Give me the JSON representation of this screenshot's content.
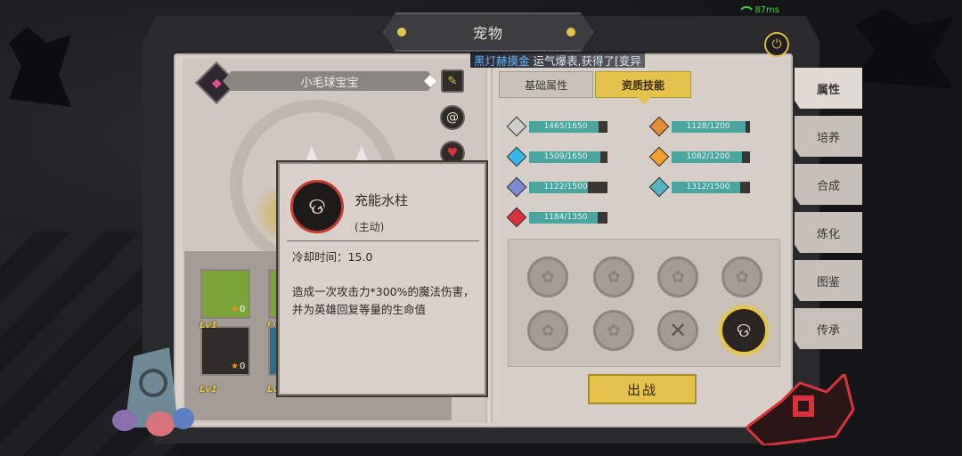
{
  "status": {
    "network": "87ms"
  },
  "header": {
    "title": "宠物"
  },
  "broadcast": {
    "player": "黑灯赫摸金",
    "message": "运气爆表,获得了[变异"
  },
  "pet": {
    "name": "小毛球宝宝"
  },
  "tabs": [
    {
      "label": "基础属性",
      "active": false
    },
    {
      "label": "资质技能",
      "active": true
    }
  ],
  "stats": [
    {
      "value": "1465/1650",
      "current": 1465,
      "max": 1650,
      "gem": "#cfcfcf"
    },
    {
      "value": "1128/1200",
      "current": 1128,
      "max": 1200,
      "gem": "#e58c3a"
    },
    {
      "value": "1509/1650",
      "current": 1509,
      "max": 1650,
      "gem": "#3ab8e5"
    },
    {
      "value": "1082/1200",
      "current": 1082,
      "max": 1200,
      "gem": "#f2a02c"
    },
    {
      "value": "1122/1500",
      "current": 1122,
      "max": 1500,
      "gem": "#7d8bd6"
    },
    {
      "value": "1312/1500",
      "current": 1312,
      "max": 1500,
      "gem": "#5ab2c8"
    },
    {
      "value": "1184/1350",
      "current": 1184,
      "max": 1350,
      "gem": "#d8333b"
    }
  ],
  "tooltip": {
    "skill_name": "充能水柱",
    "skill_type": "(主动)",
    "cooldown": "冷却时间：15.0",
    "description": "造成一次攻击力*300%的魔法伤害，并为英雄回复等量的生命值"
  },
  "pet_list": [
    {
      "level": "",
      "stars": "0"
    },
    {
      "level": "Lv1",
      "stars": "0"
    },
    {
      "level": "Lv1",
      "stars": ""
    }
  ],
  "deploy_button": "出战",
  "nav": [
    "属性",
    "培养",
    "合成",
    "炼化",
    "图鉴",
    "传承"
  ]
}
